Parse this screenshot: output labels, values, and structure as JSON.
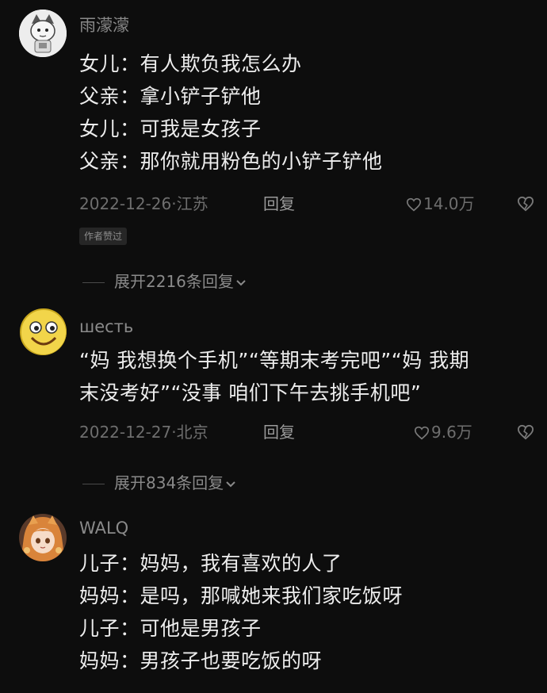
{
  "comments": [
    {
      "username": "雨濛濛",
      "lines": [
        "女儿：有人欺负我怎么办",
        "父亲：拿小铲子铲他",
        "女儿：可我是女孩子",
        "父亲：那你就用粉色的小铲子铲他"
      ],
      "date_location": "2022-12-26·江苏",
      "reply_label": "回复",
      "likes": "14.0万",
      "author_tag": "作者赞过",
      "expand_label": "展开2216条回复",
      "avatar": "cartoon-character-avatar"
    },
    {
      "username": "шесть",
      "lines": [
        "“妈 我想换个手机”“等期末考完吧”“妈 我期",
        "末没考好”“没事 咱们下午去挑手机吧”"
      ],
      "date_location": "2022-12-27·北京",
      "reply_label": "回复",
      "likes": "9.6万",
      "expand_label": "展开834条回复",
      "avatar": "smiley-face-avatar"
    },
    {
      "username": "WALQ",
      "lines": [
        "儿子：妈妈，我有喜欢的人了",
        "妈妈：是吗，那喊她来我们家吃饭呀",
        "儿子：可他是男孩子",
        "妈妈：男孩子也要吃饭的呀"
      ],
      "avatar": "anime-girl-avatar"
    }
  ],
  "icons": {
    "like": "heart-outline-icon",
    "dislike": "broken-heart-icon",
    "expand": "chevron-down-icon"
  },
  "colors": {
    "background": "#0d0d0d",
    "text": "#ededed",
    "muted": "#6e6e6e"
  }
}
